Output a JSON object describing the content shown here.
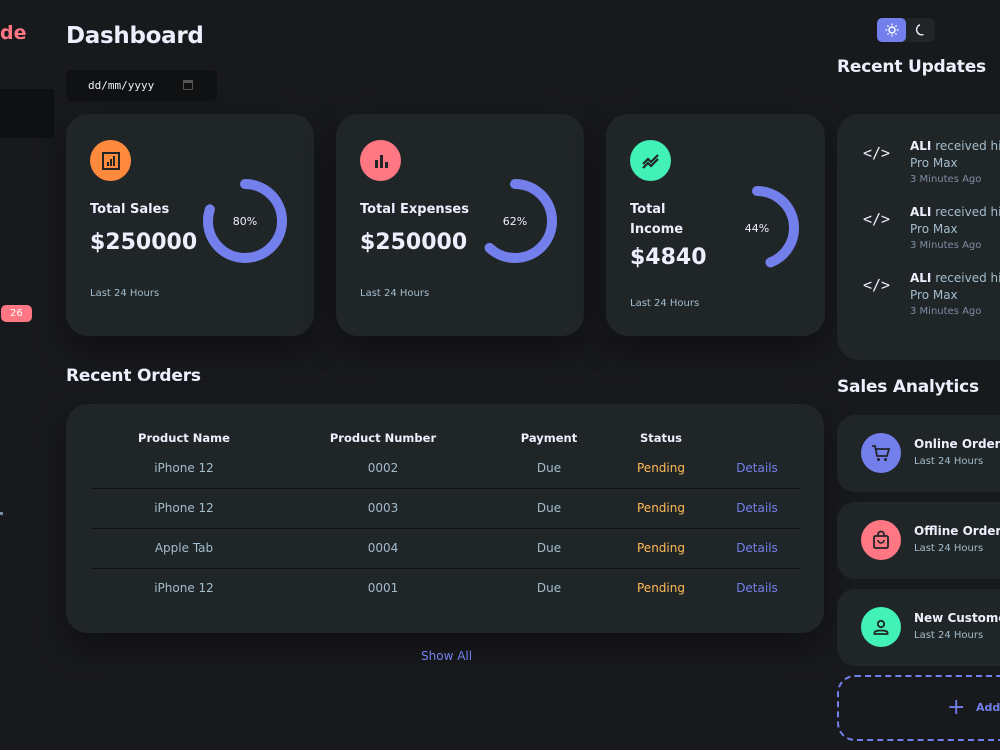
{
  "sidebar": {
    "brand": "de",
    "badge": "26"
  },
  "header": {
    "title": "Dashboard"
  },
  "date": {
    "placeholder": "dd/mm/yyyy"
  },
  "cards": [
    {
      "label": "Total Sales",
      "amount": "$250000",
      "percent": "80%",
      "fraction": 0.8,
      "footer": "Last 24 Hours",
      "color": "#ff8a3d",
      "icon": "analytics-icon"
    },
    {
      "label": "Total Expenses",
      "amount": "$250000",
      "percent": "62%",
      "fraction": 0.62,
      "footer": "Last 24 Hours",
      "color": "#ff7782",
      "icon": "bar-chart-icon"
    },
    {
      "label": "Total Income",
      "amount": "$4840",
      "percent": "44%",
      "fraction": 0.44,
      "footer": "Last 24 Hours",
      "color": "#41f1b6",
      "icon": "stacked-line-chart-icon"
    }
  ],
  "ring_color": "#7380ec",
  "orders": {
    "title": "Recent Orders",
    "headers": [
      "Product Name",
      "Product Number",
      "Payment",
      "Status",
      ""
    ],
    "rows": [
      [
        "iPhone 12",
        "0002",
        "Due",
        "Pending",
        "Details"
      ],
      [
        "iPhone 12",
        "0003",
        "Due",
        "Pending",
        "Details"
      ],
      [
        "Apple Tab",
        "0004",
        "Due",
        "Pending",
        "Details"
      ],
      [
        "iPhone 12",
        "0001",
        "Due",
        "Pending",
        "Details"
      ]
    ],
    "show_all": "Show All"
  },
  "updates": {
    "title": "Recent Updates",
    "items": [
      {
        "name": "ALI",
        "text": " received his",
        "line2": "Pro Max",
        "time": "3 Minutes Ago"
      },
      {
        "name": "ALI",
        "text": " received his",
        "line2": "Pro Max",
        "time": "3 Minutes Ago"
      },
      {
        "name": "ALI",
        "text": " received his",
        "line2": "Pro Max",
        "time": "3 Minutes Ago"
      }
    ]
  },
  "analytics": {
    "title": "Sales Analytics",
    "items": [
      {
        "title": "Online Orders",
        "sub": "Last 24 Hours",
        "color": "#7380ec",
        "icon": "cart-icon"
      },
      {
        "title": "Offline Orders",
        "sub": "Last 24 Hours",
        "color": "#ff7782",
        "icon": "shopping-bag-icon"
      },
      {
        "title": "New Customers",
        "sub": "Last 24 Hours",
        "color": "#41f1b6",
        "icon": "person-icon"
      }
    ],
    "add_label": "Add Product"
  }
}
